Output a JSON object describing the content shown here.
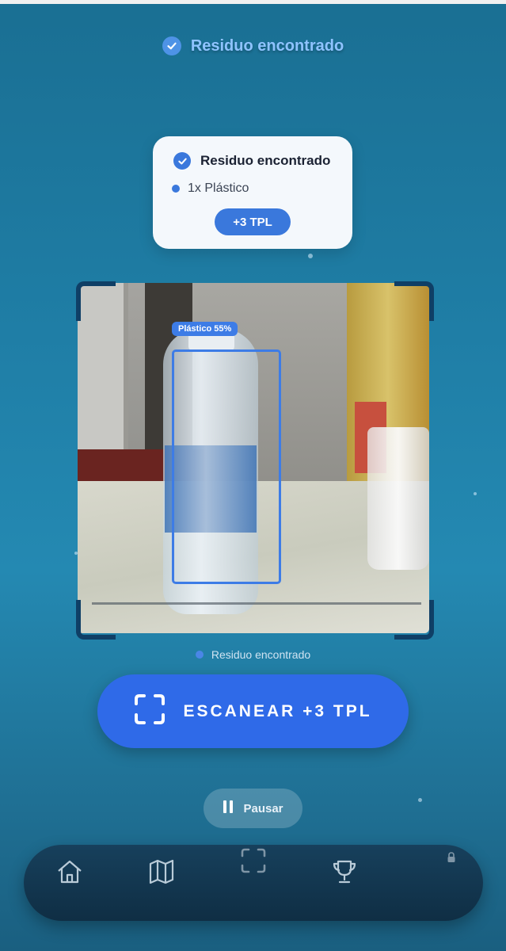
{
  "header": {
    "title": "Residuo encontrado"
  },
  "result_card": {
    "title": "Residuo encontrado",
    "item": "1x Plástico",
    "reward_label": "+3 TPL"
  },
  "detection": {
    "label": "Plástico 55%",
    "class": "Plástico",
    "confidence_percent": 55
  },
  "status": {
    "text": "Residuo encontrado"
  },
  "scan_button": {
    "label": "ESCANEAR +3 TPL"
  },
  "pause_button": {
    "label": "Pausar"
  },
  "nav": {
    "items": [
      {
        "icon": "home-icon"
      },
      {
        "icon": "map-icon"
      },
      {
        "icon": "scan-icon",
        "active": true
      },
      {
        "icon": "trophy-icon"
      },
      {
        "icon": "lock-icon"
      }
    ]
  },
  "colors": {
    "accent": "#3a78dc",
    "scan_button": "#2f6ae8",
    "header_text": "#8ec3ff",
    "nav_bg": "#0f2e44"
  }
}
